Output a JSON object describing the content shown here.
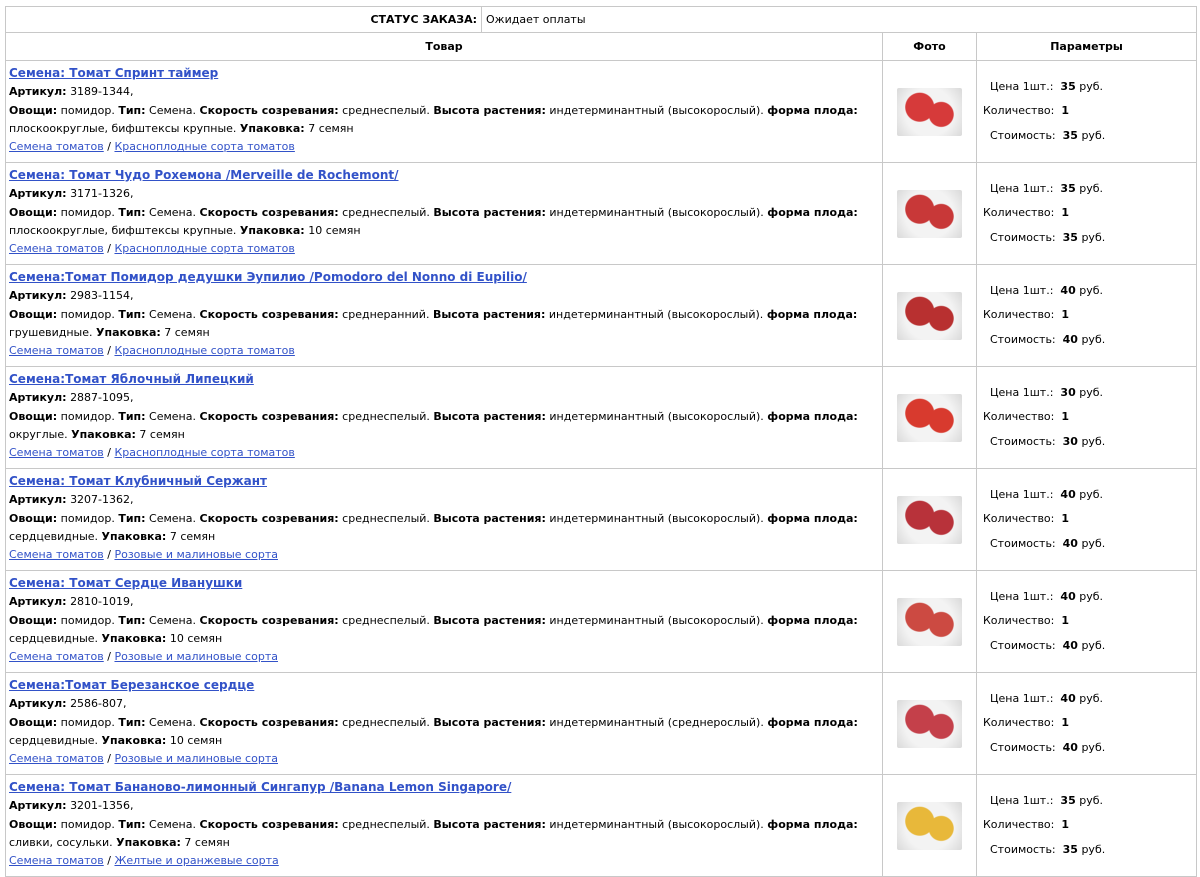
{
  "status": {
    "label": "СТАТУС ЗАКАЗА:",
    "value": "Ожидает оплаты"
  },
  "headers": {
    "product": "Товар",
    "photo": "Фото",
    "params": "Параметры"
  },
  "labels": {
    "article": "Артикул:",
    "vegetables": "Овощи:",
    "type": "Тип:",
    "ripening": "Скорость созревания:",
    "height": "Высота растения:",
    "fruit_shape": "форма плода:",
    "package": "Упаковка:",
    "price": "Цена 1шт.:",
    "qty": "Количество:",
    "cost": "Стоимость:",
    "rub": "руб.",
    "separator": "/"
  },
  "colors": {
    "link": "#3252c8",
    "border": "#c8c8c8"
  },
  "products": [
    {
      "title": "Семена: Томат Спринт таймер",
      "article": "3189-1344,",
      "veg": "помидор.",
      "type": "Семена.",
      "ripening": "среднеспелый.",
      "height": "индетерминантный (высокорослый).",
      "shape": "плоскоокруглые, бифштексы крупные.",
      "package": "7 семян",
      "cat1": "Семена томатов",
      "cat2": "Красноплодные сорта томатов",
      "price": "35",
      "qty": "1",
      "cost": "35",
      "photo_color": "#d63a3a",
      "photo_icon": "tomato-photo"
    },
    {
      "title": "Семена: Томат Чудо Рохемона /Merveille de Rochemont/",
      "article": "3171-1326,",
      "veg": "помидор.",
      "type": "Семена.",
      "ripening": "среднеспелый.",
      "height": "индетерминантный (высокорослый).",
      "shape": "плоскоокруглые, бифштексы крупные.",
      "package": "10 семян",
      "cat1": "Семена томатов",
      "cat2": "Красноплодные сорта томатов",
      "price": "35",
      "qty": "1",
      "cost": "35",
      "photo_color": "#c83838",
      "photo_icon": "tomato-photo"
    },
    {
      "title": "Семена:Томат Помидор дедушки Эупилио /Pomodoro del Nonno di Eupilio/",
      "article": "2983-1154,",
      "veg": "помидор.",
      "type": "Семена.",
      "ripening": "среднеранний.",
      "height": "индетерминантный (высокорослый).",
      "shape": "грушевидные.",
      "package": "7 семян",
      "cat1": "Семена томатов",
      "cat2": "Красноплодные сорта томатов",
      "price": "40",
      "qty": "1",
      "cost": "40",
      "photo_color": "#b83030",
      "photo_icon": "tomato-photo"
    },
    {
      "title": "Семена:Томат Яблочный Липецкий",
      "article": "2887-1095,",
      "veg": "помидор.",
      "type": "Семена.",
      "ripening": "среднеспелый.",
      "height": "индетерминантный (высокорослый).",
      "shape": "округлые.",
      "package": "7 семян",
      "cat1": "Семена томатов",
      "cat2": "Красноплодные сорта томатов",
      "price": "30",
      "qty": "1",
      "cost": "30",
      "photo_color": "#d83a2e",
      "photo_icon": "tomato-photo"
    },
    {
      "title": "Семена: Томат Клубничный Сержант",
      "article": "3207-1362,",
      "veg": "помидор.",
      "type": "Семена.",
      "ripening": "среднеспелый.",
      "height": "индетерминантный (высокорослый).",
      "shape": "сердцевидные.",
      "package": "7 семян",
      "cat1": "Семена томатов",
      "cat2": "Розовые и малиновые сорта",
      "price": "40",
      "qty": "1",
      "cost": "40",
      "photo_color": "#b8323a",
      "photo_icon": "tomato-photo"
    },
    {
      "title": "Семена: Томат Сердце Иванушки",
      "article": "2810-1019,",
      "veg": "помидор.",
      "type": "Семена.",
      "ripening": "среднеспелый.",
      "height": "индетерминантный (высокорослый).",
      "shape": "сердцевидные.",
      "package": "10 семян",
      "cat1": "Семена томатов",
      "cat2": "Розовые и малиновые сорта",
      "price": "40",
      "qty": "1",
      "cost": "40",
      "photo_color": "#cc4a42",
      "photo_icon": "tomato-photo"
    },
    {
      "title": "Семена:Томат Березанское сердце",
      "article": "2586-807,",
      "veg": "помидор.",
      "type": "Семена.",
      "ripening": "среднеспелый.",
      "height": "индетерминантный (среднерослый).",
      "shape": "сердцевидные.",
      "package": "10 семян",
      "cat1": "Семена томатов",
      "cat2": "Розовые и малиновые сорта",
      "price": "40",
      "qty": "1",
      "cost": "40",
      "photo_color": "#c4404a",
      "photo_icon": "tomato-photo"
    },
    {
      "title": "Семена: Томат Бананово-лимонный Сингапур /Banana Lemon Singapore/",
      "article": "3201-1356,",
      "veg": "помидор.",
      "type": "Семена.",
      "ripening": "среднеспелый.",
      "height": "индетерминантный (высокорослый).",
      "shape": "сливки, сосульки.",
      "package": "7 семян",
      "cat1": "Семена томатов",
      "cat2": "Желтые и оранжевые сорта",
      "price": "35",
      "qty": "1",
      "cost": "35",
      "photo_color": "#e8b83a",
      "photo_icon": "tomato-photo"
    }
  ]
}
